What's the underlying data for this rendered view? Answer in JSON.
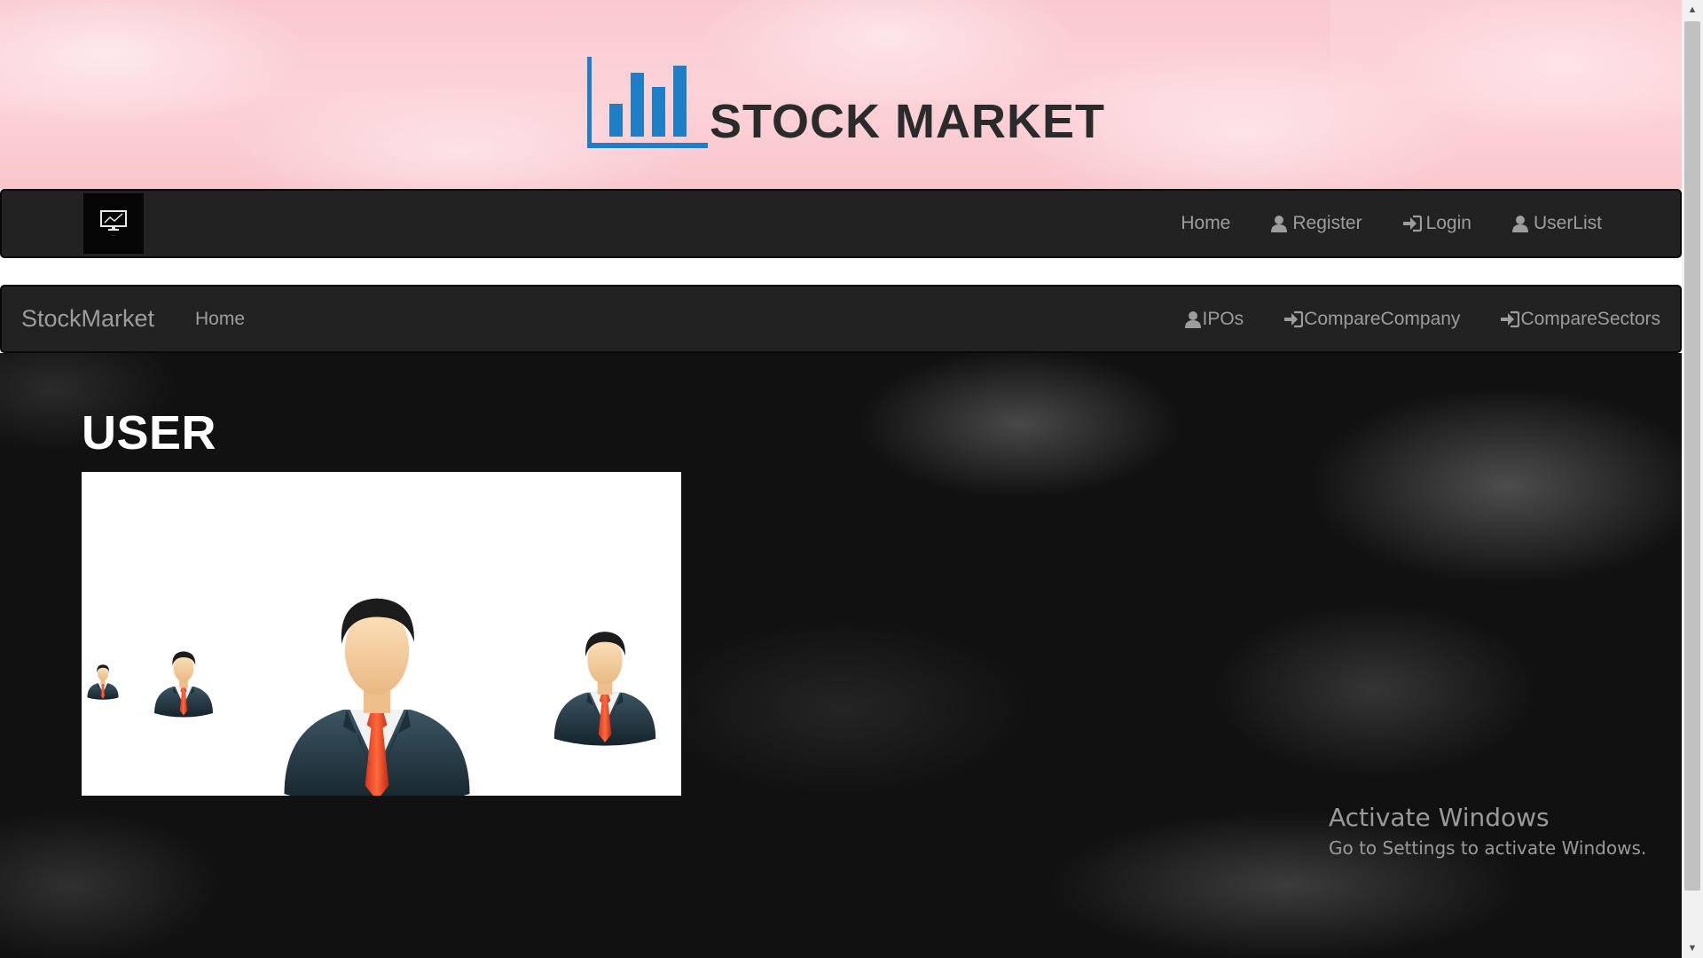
{
  "banner": {
    "brand_text": "STOCK MARKET",
    "logo_icon": "bar-chart-icon",
    "logo_color": "#1f7fc6"
  },
  "topnav": {
    "logo_icon": "monitor-chart-icon",
    "links": [
      {
        "label": "Home",
        "icon": null
      },
      {
        "label": "Register",
        "icon": "user-icon"
      },
      {
        "label": "Login",
        "icon": "login-icon"
      },
      {
        "label": "UserList",
        "icon": "user-icon"
      }
    ]
  },
  "secnav": {
    "brand": "StockMarket",
    "home": "Home",
    "links": [
      {
        "label": "IPOs",
        "icon": "user-icon"
      },
      {
        "label": "CompareCompany",
        "icon": "login-icon"
      },
      {
        "label": "CompareSectors",
        "icon": "login-icon"
      }
    ]
  },
  "main": {
    "heading": "USER",
    "image_alt_icon": "businessman-user-icons"
  },
  "watermark": {
    "line1": "Activate Windows",
    "line2": "Go to Settings to activate Windows."
  },
  "colors": {
    "navbar_bg": "#222222",
    "nav_text": "#9d9d9d",
    "banner_pink": "#fcd3d8"
  }
}
